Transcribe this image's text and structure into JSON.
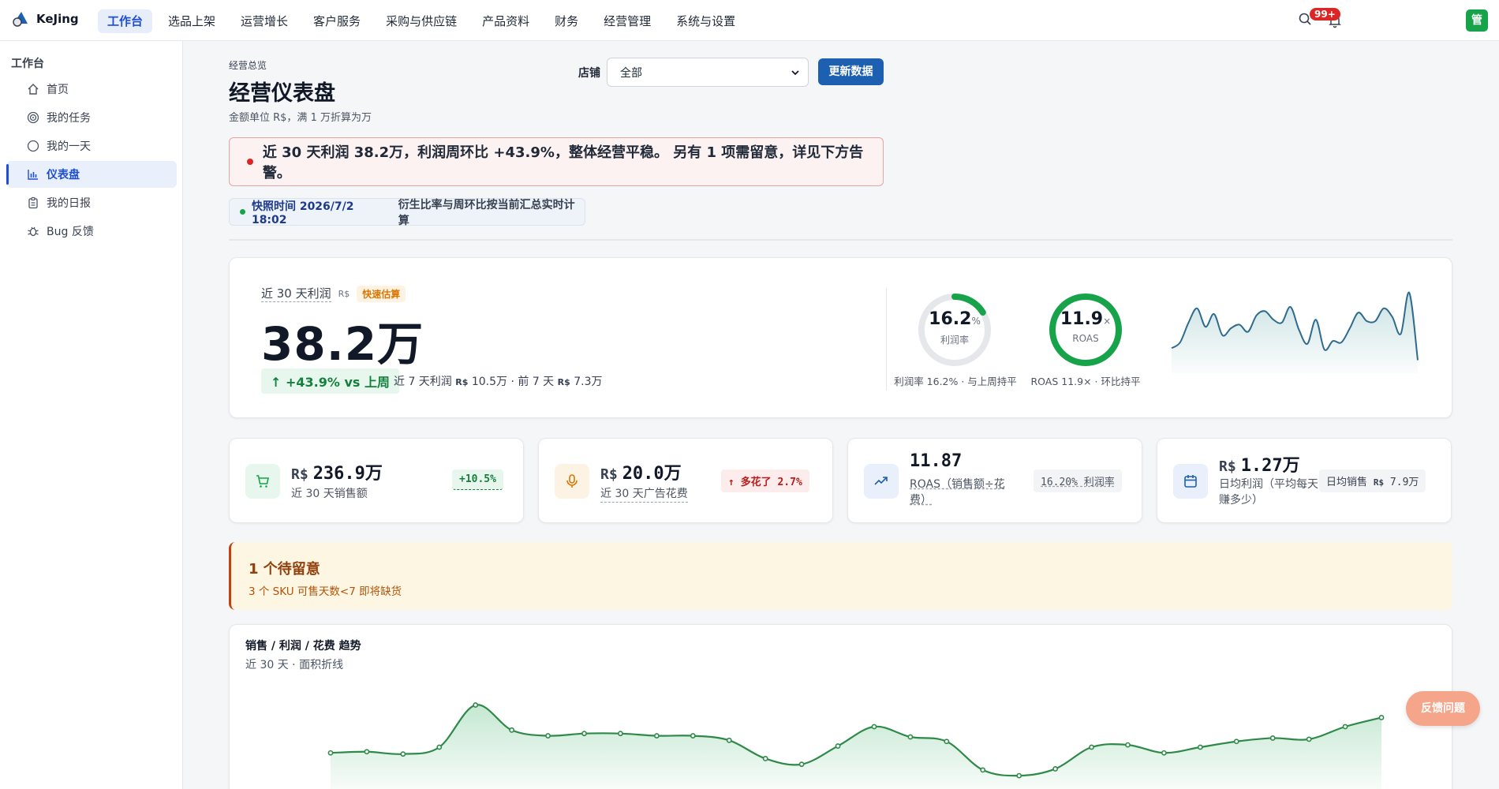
{
  "app": {
    "name": "KeJing"
  },
  "nav": {
    "items": [
      "工作台",
      "选品上架",
      "运营增长",
      "客户服务",
      "采购与供应链",
      "产品资料",
      "财务",
      "经营管理",
      "系统与设置"
    ],
    "active_index": 0
  },
  "topbar": {
    "badge": "99+",
    "avatar": "管"
  },
  "sidebar": {
    "title": "工作台",
    "items": [
      "首页",
      "我的任务",
      "我的一天",
      "仪表盘",
      "我的日报",
      "Bug 反馈"
    ],
    "active_index": 3
  },
  "header": {
    "breadcrumb": "经营总览",
    "title": "经营仪表盘",
    "subtitle": "金额单位 R$，满 1 万折算为万",
    "store_label": "店铺",
    "store_value": "全部",
    "refresh_label": "更新数据"
  },
  "alert": {
    "text": "近 30 天利润 38.2万，利润周环比 +43.9%，整体经营平稳。 另有 1 项需留意，详见下方告警。"
  },
  "snapshot": {
    "time": "快照时间 2026/7/2 18:02",
    "note": "衍生比率与周环比按当前汇总实时计算"
  },
  "hero": {
    "label": "近 30 天利润",
    "currency": "R$",
    "tag": "快速估算",
    "value": "38.2万",
    "delta": "↑ +43.9% vs 上周",
    "detail_a": "近 7 天利润",
    "detail_cur_a": "R$",
    "detail_b": "10.5万 · 前 7 天",
    "detail_cur_b": "R$",
    "detail_c": "7.3万",
    "margin": {
      "value": "16.2",
      "unit": "%",
      "label": "利润率",
      "caption": "利润率 16.2% · 与上周持平",
      "fraction": 0.162
    },
    "roas": {
      "value": "11.9",
      "unit": "×",
      "label": "ROAS",
      "caption": "ROAS 11.9× · 环比持平",
      "fraction": 1.0
    },
    "sparkline": [
      22,
      30,
      58,
      78,
      52,
      70,
      40,
      50,
      55,
      45,
      68,
      74,
      62,
      58,
      80,
      48,
      28,
      62,
      20,
      32,
      30,
      50,
      72,
      60,
      60,
      78,
      66,
      42,
      100,
      5
    ]
  },
  "kpis": [
    {
      "currency": "R$",
      "value": "236.9万",
      "label": "近 30 天销售额",
      "chip": "+10.5%",
      "icon": "cart-icon"
    },
    {
      "currency": "R$",
      "value": "20.0万",
      "label": "近 30 天广告花费",
      "chip": "↑ 多花了 2.7%",
      "icon": "mic-icon"
    },
    {
      "currency": "",
      "value": "11.87",
      "label": "ROAS（销售额÷花费）",
      "chip": "16.20% 利润率",
      "icon": "trend-up-icon"
    },
    {
      "currency": "R$",
      "value": "1.27万",
      "label": "日均利润（平均每天赚多少）",
      "chip_a": "日均销售",
      "chip_cur": "R$",
      "chip_b": "7.9万",
      "icon": "calendar-icon"
    }
  ],
  "warning": {
    "title": "1 个待留意",
    "body": "3 个 SKU 可售天数<7 即将缺货"
  },
  "trend": {
    "title": "销售 / 利润 / 花费 趋势",
    "subtitle": "近 30 天 · 面积折线"
  },
  "fab": {
    "label": "反馈问题"
  },
  "colors": {
    "primary": "#1d5fb0",
    "green": "#15803d",
    "red": "#dc2626",
    "amber": "#d97706"
  },
  "chart_data": {
    "type": "area",
    "title": "销售 / 利润 / 花费 趋势",
    "x": [
      1,
      2,
      3,
      4,
      5,
      6,
      7,
      8,
      9,
      10,
      11,
      12,
      13,
      14,
      15,
      16,
      17,
      18,
      19,
      20,
      21,
      22,
      23,
      24,
      25,
      26,
      27,
      28,
      29,
      30
    ],
    "series": [
      {
        "values": [
          40,
          41,
          39,
          45,
          82,
          60,
          55,
          57,
          57,
          55,
          55,
          51,
          35,
          30,
          46,
          63,
          54,
          50,
          25,
          20,
          26,
          45,
          47,
          40,
          45,
          50,
          53,
          52,
          63,
          71
        ]
      }
    ]
  }
}
